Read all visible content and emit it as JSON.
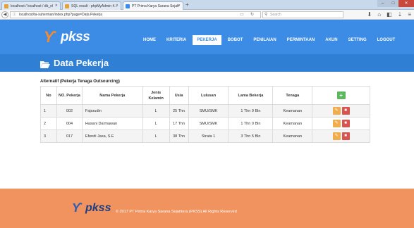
{
  "browser": {
    "tabs": [
      {
        "label": "localhost / localhost / db_el"
      },
      {
        "label": "SQL result - phpMyAdmin 4..."
      },
      {
        "label": "PT Prima Karya Sarana Sejah"
      }
    ],
    "url": "localhost/ta-suherman/index.php?page=Data Pekerja",
    "search_placeholder": "Search"
  },
  "header": {
    "logo_text": "pkss",
    "nav": [
      "HOME",
      "KRITERIA",
      "PEKERJA",
      "BOBOT",
      "PENILAIAN",
      "PERMINTAAN",
      "AKUN",
      "SETTING",
      "LOGOUT"
    ],
    "active_nav": "PEKERJA"
  },
  "page": {
    "title": "Data Pekerja",
    "subtitle": "Alternatif (Pekerja Tenaga Outsourcing)"
  },
  "table": {
    "headers": [
      "No",
      "NO. Pekerja",
      "Nama Pekerja",
      "Jenis Kelamin",
      "Usia",
      "Lulusan",
      "Lama Bekerja",
      "Tenaga"
    ],
    "add_label": "+",
    "rows": [
      {
        "no": "1",
        "no_pekerja": "002",
        "nama": "Fajarudin",
        "jk": "L",
        "usia": "25 Thn",
        "lulusan": "SMU/SMK",
        "lama": "1 Thn 9 Bln",
        "tenaga": "Keamanan"
      },
      {
        "no": "2",
        "no_pekerja": "004",
        "nama": "Hasani Darmawan",
        "jk": "L",
        "usia": "17 Thn",
        "lulusan": "SMU/SMK",
        "lama": "1 Thn 0 Bln",
        "tenaga": "Keamanan"
      },
      {
        "no": "3",
        "no_pekerja": "017",
        "nama": "Efendi Jasa, S.E",
        "jk": "L",
        "usia": "38 Thn",
        "lulusan": "Strata 1",
        "lama": "3 Thn 5 Bln",
        "tenaga": "Keamanan"
      }
    ]
  },
  "footer": {
    "logo_text": "pkss",
    "copyright": "© 2017 PT Prima Karya Sarana Sejahtera (PKSS) All Rights Reserved"
  },
  "colors": {
    "header": "#3c8be4",
    "title_bar": "#2f7fd4",
    "footer": "#f0935e",
    "add_button": "#5cb85c",
    "edit_button": "#f0ad4e",
    "delete_button": "#d9534f"
  }
}
